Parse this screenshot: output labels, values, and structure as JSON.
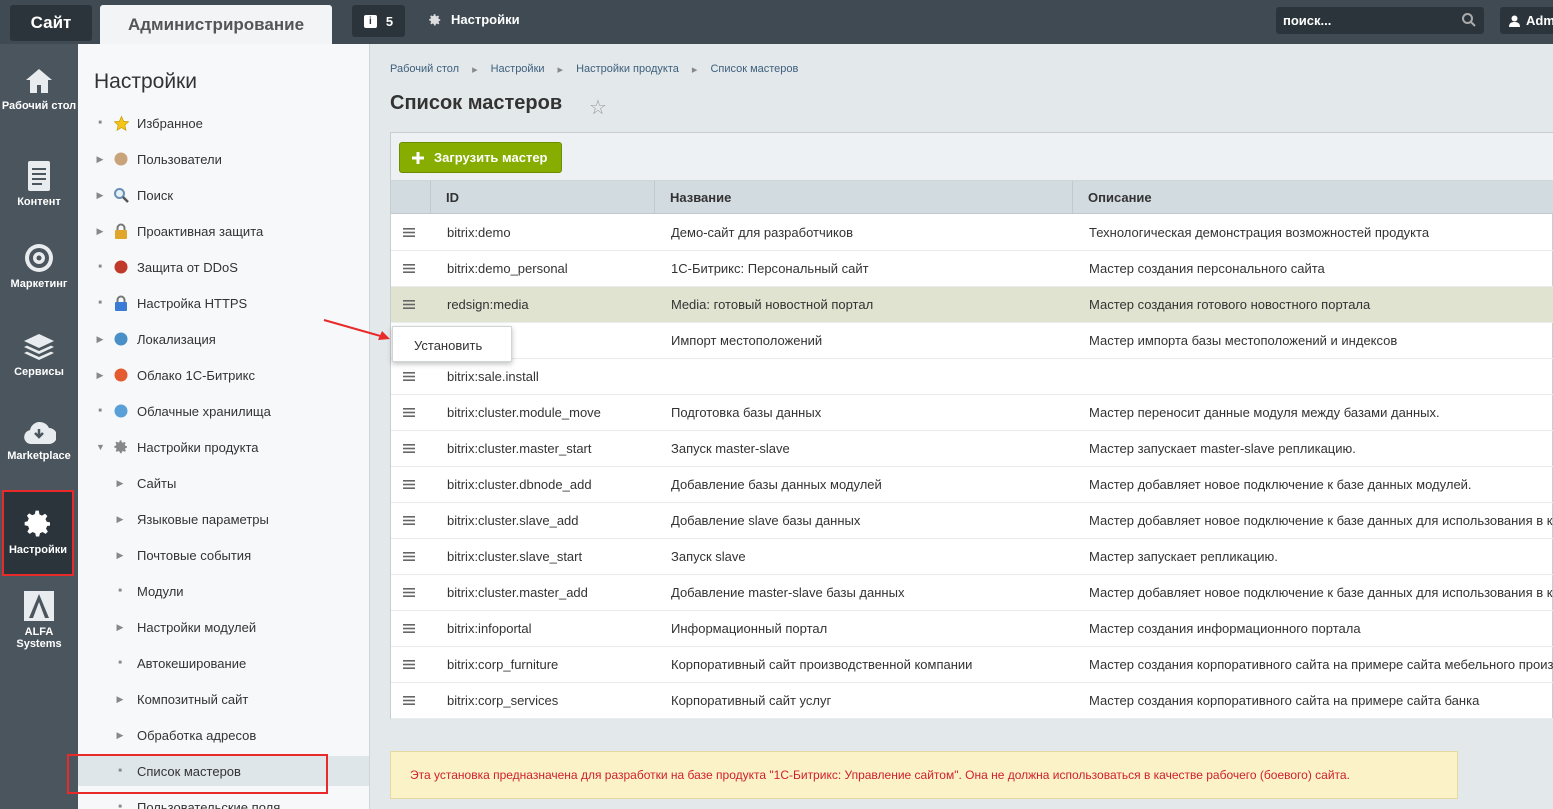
{
  "topbar": {
    "site_tab": "Сайт",
    "admin_tab": "Администрирование",
    "notifications_count": "5",
    "settings_label": "Настройки",
    "search_placeholder": "поиск...",
    "user_label": "Adm"
  },
  "left_nav": [
    {
      "label": "Рабочий стол",
      "icon": "home-icon"
    },
    {
      "label": "Контент",
      "icon": "document-icon"
    },
    {
      "label": "Маркетинг",
      "icon": "target-icon"
    },
    {
      "label": "Сервисы",
      "icon": "layers-icon"
    },
    {
      "label": "Marketplace",
      "icon": "cloud-download-icon"
    },
    {
      "label": "Настройки",
      "icon": "gear-icon",
      "active": true
    },
    {
      "label": "ALFA Systems",
      "icon": "alfa-logo-icon"
    }
  ],
  "sidebar": {
    "title": "Настройки",
    "items": [
      {
        "label": "Избранное",
        "icon": "star-icon"
      },
      {
        "label": "Пользователи",
        "icon": "user-icon"
      },
      {
        "label": "Поиск",
        "icon": "search-icon"
      },
      {
        "label": "Проактивная защита",
        "icon": "lock-icon"
      },
      {
        "label": "Защита от DDoS",
        "icon": "shield-icon"
      },
      {
        "label": "Настройка HTTPS",
        "icon": "https-lock-icon"
      },
      {
        "label": "Локализация",
        "icon": "globe-icon"
      },
      {
        "label": "Облако 1С-Битрикс",
        "icon": "cloud-icon"
      },
      {
        "label": "Облачные хранилища",
        "icon": "storage-icon"
      },
      {
        "label": "Настройки продукта",
        "icon": "gear-icon"
      },
      {
        "label": "Сайты"
      },
      {
        "label": "Языковые параметры"
      },
      {
        "label": "Почтовые события"
      },
      {
        "label": "Модули"
      },
      {
        "label": "Настройки модулей"
      },
      {
        "label": "Автокеширование"
      },
      {
        "label": "Композитный сайт"
      },
      {
        "label": "Обработка адресов"
      },
      {
        "label": "Список мастеров"
      },
      {
        "label": "Пользовательские поля"
      }
    ]
  },
  "breadcrumb": [
    "Рабочий стол",
    "Настройки",
    "Настройки продукта",
    "Список мастеров"
  ],
  "page_title": "Список мастеров",
  "toolbar": {
    "load_button": "Загрузить мастер"
  },
  "table": {
    "columns": [
      "ID",
      "Название",
      "Описание"
    ],
    "rows": [
      {
        "id": "bitrix:demo",
        "name": "Демо-сайт для разработчиков",
        "desc": "Технологическая демонстрация возможностей продукта"
      },
      {
        "id": "bitrix:demo_personal",
        "name": "1С-Битрикс: Персональный сайт",
        "desc": "Мастер создания персонального сайта"
      },
      {
        "id": "redsign:media",
        "name": "Media: готовый новостной портал",
        "desc": "Мастер создания готового новостного портала"
      },
      {
        "id": "ocations",
        "name": "Импорт местоположений",
        "desc": "Мастер импорта базы местоположений и индексов"
      },
      {
        "id": "bitrix:sale.install",
        "name": "",
        "desc": ""
      },
      {
        "id": "bitrix:cluster.module_move",
        "name": "Подготовка базы данных",
        "desc": "Мастер переносит данные модуля между базами данных."
      },
      {
        "id": "bitrix:cluster.master_start",
        "name": "Запуск master-slave",
        "desc": "Мастер запускает master-slave репликацию."
      },
      {
        "id": "bitrix:cluster.dbnode_add",
        "name": "Добавление базы данных модулей",
        "desc": "Мастер добавляет новое подключение к базе данных модулей."
      },
      {
        "id": "bitrix:cluster.slave_add",
        "name": "Добавление slave базы данных",
        "desc": "Мастер добавляет новое подключение к базе данных для использования в к"
      },
      {
        "id": "bitrix:cluster.slave_start",
        "name": "Запуск slave",
        "desc": "Мастер запускает репликацию."
      },
      {
        "id": "bitrix:cluster.master_add",
        "name": "Добавление master-slave базы данных",
        "desc": "Мастер добавляет новое подключение к базе данных для использования в к"
      },
      {
        "id": "bitrix:infoportal",
        "name": "Информационный портал",
        "desc": "Мастер создания информационного портала"
      },
      {
        "id": "bitrix:corp_furniture",
        "name": "Корпоративный сайт производственной компании",
        "desc": "Мастер создания корпоративного сайта на примере сайта мебельного произ"
      },
      {
        "id": "bitrix:corp_services",
        "name": "Корпоративный сайт услуг",
        "desc": "Мастер создания корпоративного сайта на примере сайта банка"
      }
    ]
  },
  "context_menu": {
    "install": "Установить"
  },
  "warning": "Эта установка предназначена для разработки на базе продукта \"1С-Битрикс: Управление сайтом\". Она не должна использоваться в качестве рабочего (боевого) сайта.",
  "colors": {
    "accent_green": "#86ad00",
    "highlight_red": "#e82a2a",
    "warning_text": "#d0202c"
  }
}
